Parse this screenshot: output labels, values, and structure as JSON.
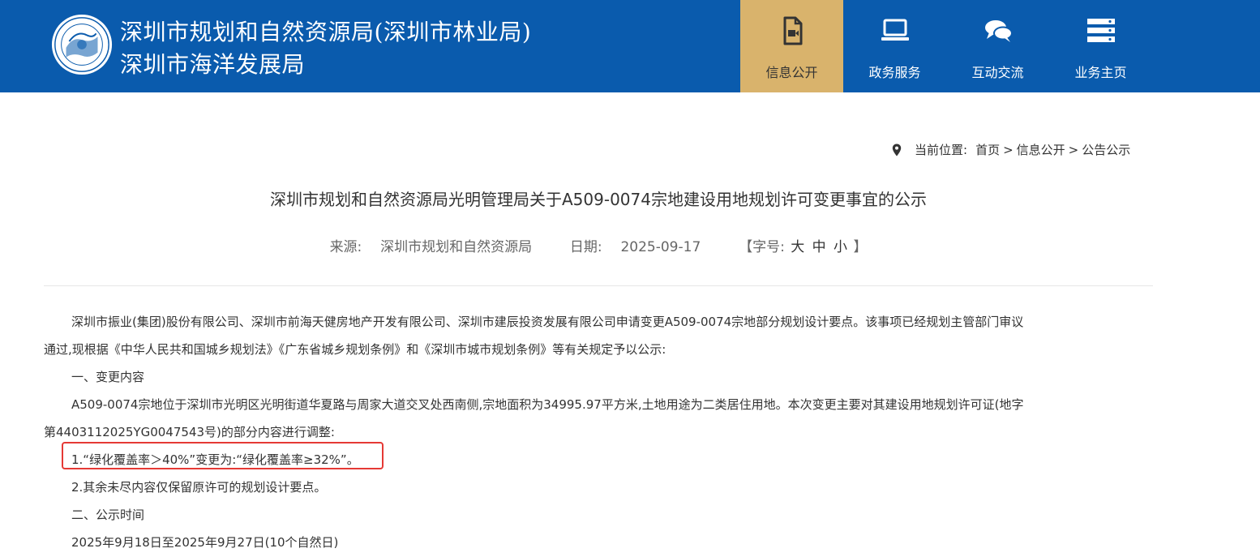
{
  "header": {
    "org_name_line1": "深圳市规划和自然资源局(深圳市林业局)",
    "org_name_line2": "深圳市海洋发展局",
    "background_color": "#0a5bad",
    "logo_icon": "government-emblem-icon"
  },
  "nav": [
    {
      "label": "信息公开",
      "icon": "video-file-icon",
      "active": true,
      "active_color": "#d9b36c"
    },
    {
      "label": "政务服务",
      "icon": "laptop-icon",
      "active": false
    },
    {
      "label": "互动交流",
      "icon": "chat-bubbles-icon",
      "active": false
    },
    {
      "label": "业务主页",
      "icon": "server-stack-icon",
      "active": false
    }
  ],
  "breadcrumb": {
    "icon": "location-pin-icon",
    "prefix": "当前位置:",
    "items": [
      "首页",
      "信息公开",
      "公告公示"
    ],
    "separator": ">"
  },
  "article": {
    "title": "深圳市规划和自然资源局光明管理局关于A509-0074宗地建设用地规划许可变更事宜的公示",
    "source_label": "来源:",
    "source_value": "深圳市规划和自然资源局",
    "date_label": "日期:",
    "date_value": "2025-09-17",
    "font_size_prefix": "【字号:",
    "font_size_options": [
      "大",
      "中",
      "小"
    ],
    "font_size_suffix": "】",
    "paragraphs": [
      "深圳市振业(集团)股份有限公司、深圳市前海天健房地产开发有限公司、深圳市建辰投资发展有限公司申请变更A509-0074宗地部分规划设计要点。该事项已经规划主管部门审议",
      "通过,现根据《中华人民共和国城乡规划法》《广东省城乡规划条例》和《深圳市城市规划条例》等有关规定予以公示:",
      "一、变更内容",
      "A509-0074宗地位于深圳市光明区光明街道华夏路与周家大道交叉处西南侧,宗地面积为34995.97平方米,土地用途为二类居住用地。本次变更主要对其建设用地规划许可证(地字",
      "第4403112025YG0047543号)的部分内容进行调整:",
      "1.“绿化覆盖率＞40%”变更为:“绿化覆盖率≥32%”。",
      "2.其余未尽内容仅保留原许可的规划设计要点。",
      "二、公示时间",
      "2025年9月18日至2025年9月27日(10个自然日)"
    ],
    "highlight_color": "#e53935"
  }
}
